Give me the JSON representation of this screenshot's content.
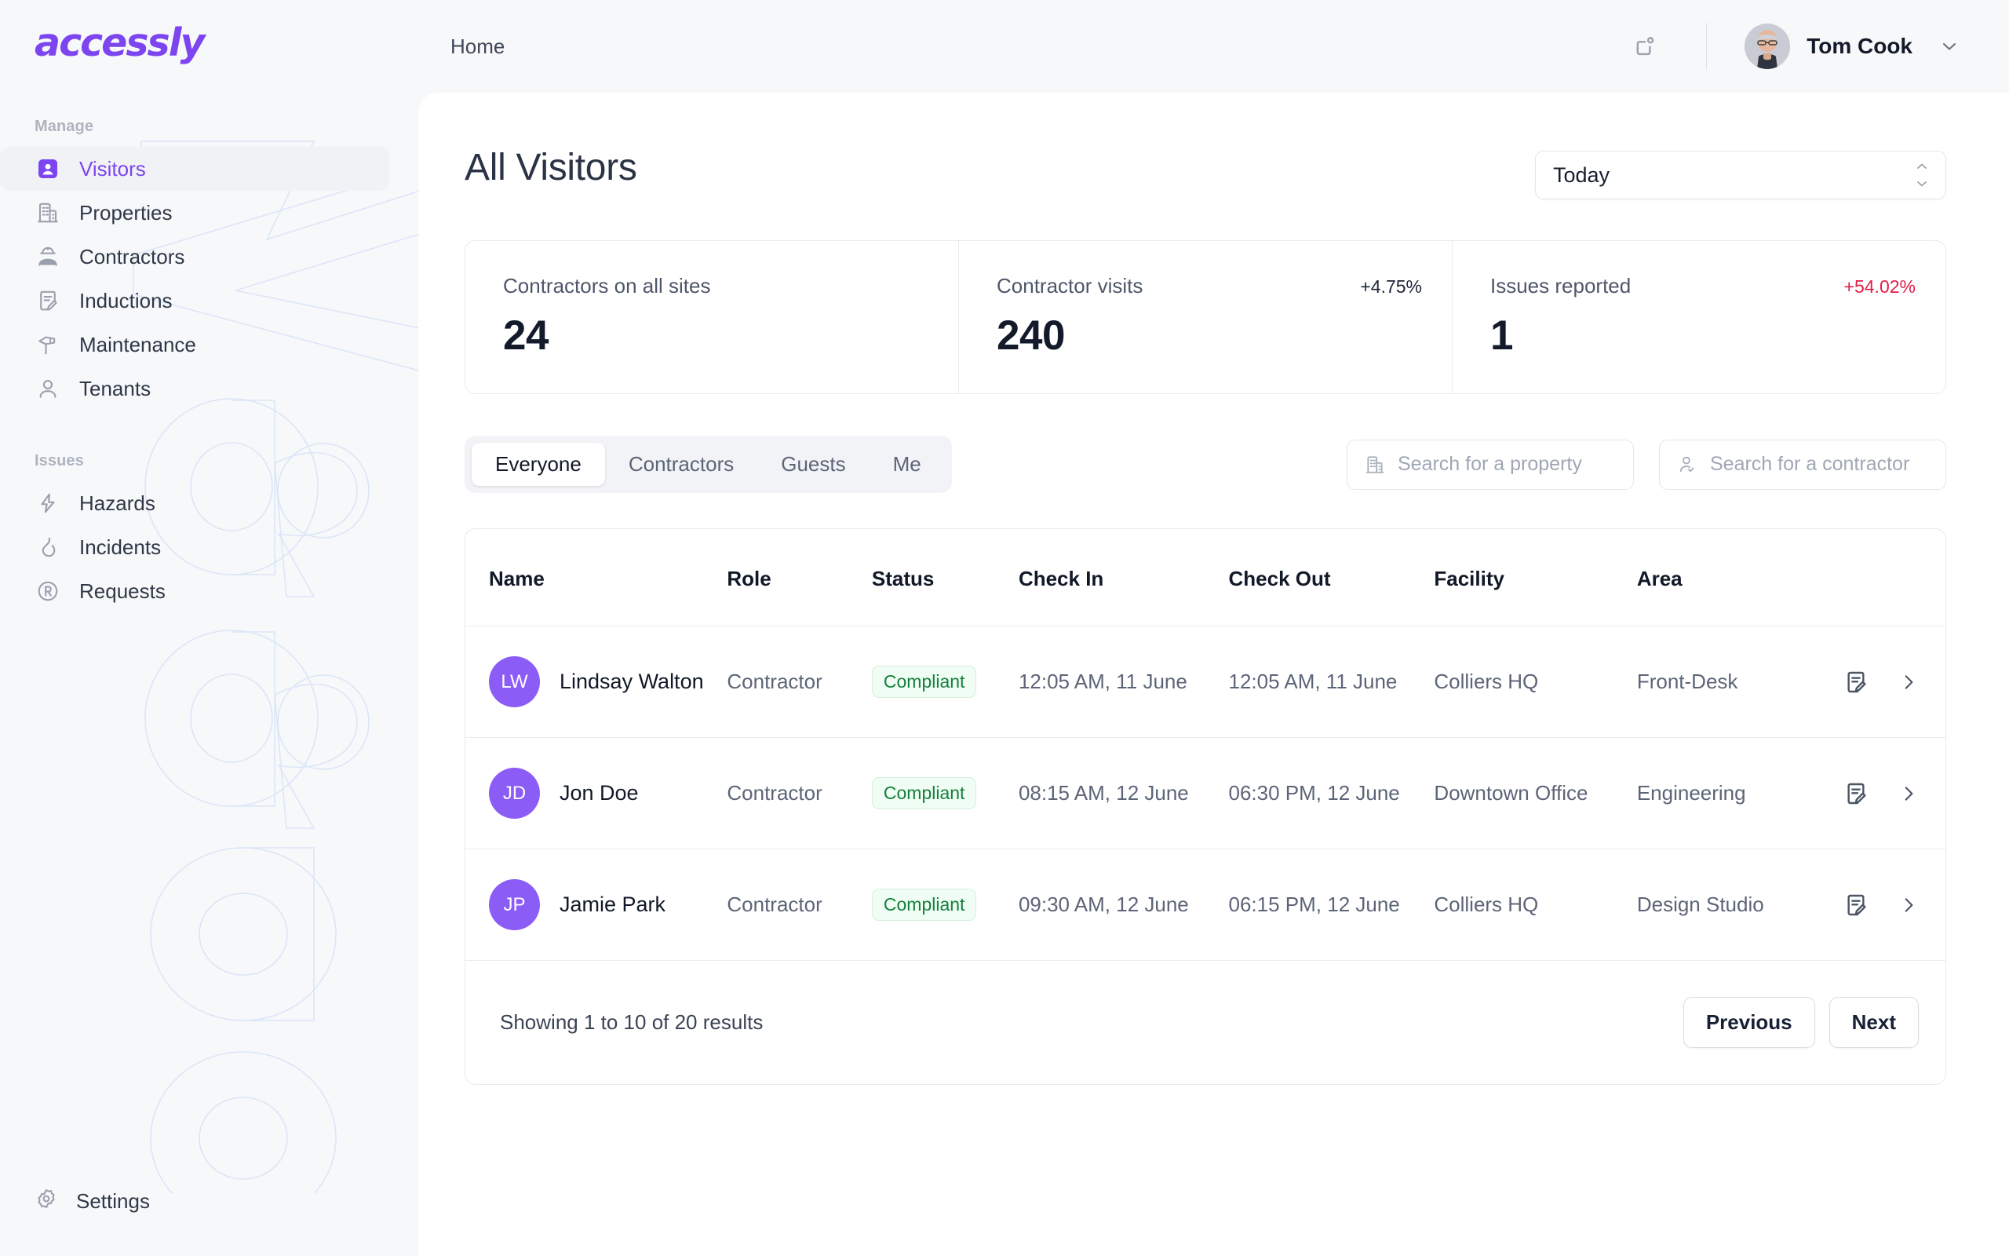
{
  "brand": {
    "logo_text": "accessly",
    "accent": "#7c45f0"
  },
  "topbar": {
    "breadcrumb": "Home",
    "notification_icon": "notification-square-icon",
    "user_name": "Tom Cook",
    "chevron_icon": "chevron-down-icon"
  },
  "sidebar": {
    "sections": [
      {
        "label": "Manage",
        "items": [
          {
            "label": "Visitors",
            "icon": "user-card-icon",
            "active": true
          },
          {
            "label": "Properties",
            "icon": "building-icon",
            "active": false
          },
          {
            "label": "Contractors",
            "icon": "hardhat-worker-icon",
            "active": false
          },
          {
            "label": "Inductions",
            "icon": "document-edit-icon",
            "active": false
          },
          {
            "label": "Maintenance",
            "icon": "hammer-icon",
            "active": false
          },
          {
            "label": "Tenants",
            "icon": "person-icon",
            "active": false
          }
        ]
      },
      {
        "label": "Issues",
        "items": [
          {
            "label": "Hazards",
            "icon": "lightning-bolt-icon",
            "active": false
          },
          {
            "label": "Incidents",
            "icon": "flame-icon",
            "active": false
          },
          {
            "label": "Requests",
            "icon": "registered-circle-icon",
            "active": false
          }
        ]
      }
    ],
    "settings": {
      "label": "Settings",
      "icon": "gear-icon"
    },
    "watermark_text": "accessly"
  },
  "main": {
    "page_title": "All Visitors",
    "date_filter": {
      "value": "Today",
      "icon": "up-down-chevron-icon"
    },
    "stats": [
      {
        "label": "Contractors on all sites",
        "value": "24",
        "delta": "",
        "delta_negative": false
      },
      {
        "label": "Contractor visits",
        "value": "240",
        "delta": "+4.75%",
        "delta_negative": false
      },
      {
        "label": "Issues reported",
        "value": "1",
        "delta": "+54.02%",
        "delta_negative": true
      }
    ],
    "tabs": [
      {
        "label": "Everyone",
        "active": true
      },
      {
        "label": "Contractors",
        "active": false
      },
      {
        "label": "Guests",
        "active": false
      },
      {
        "label": "Me",
        "active": false
      }
    ],
    "searches": [
      {
        "placeholder": "Search for a property",
        "value": "",
        "icon": "building-icon",
        "name": "property-search-input"
      },
      {
        "placeholder": "Search for a contractor",
        "value": "",
        "icon": "person-check-icon",
        "name": "contractor-search-input"
      }
    ],
    "table": {
      "columns": [
        "Name",
        "Role",
        "Status",
        "Check In",
        "Check Out",
        "Facility",
        "Area",
        ""
      ],
      "rows": [
        {
          "initials": "LW",
          "name": "Lindsay Walton",
          "role": "Contractor",
          "status": "Compliant",
          "check_in": "12:05 AM, 11 June",
          "check_out": "12:05 AM, 11 June",
          "facility": "Colliers HQ",
          "area": "Front-Desk"
        },
        {
          "initials": "JD",
          "name": "Jon Doe",
          "role": "Contractor",
          "status": "Compliant",
          "check_in": "08:15 AM, 12 June",
          "check_out": "06:30 PM, 12 June",
          "facility": "Downtown Office",
          "area": "Engineering"
        },
        {
          "initials": "JP",
          "name": "Jamie Park",
          "role": "Contractor",
          "status": "Compliant",
          "check_in": "09:30 AM, 12 June",
          "check_out": "06:15 PM, 12 June",
          "facility": "Colliers HQ",
          "area": "Design Studio"
        }
      ],
      "row_actions": {
        "edit_icon": "document-edit-icon",
        "open_icon": "chevron-right-icon"
      }
    },
    "pagination": {
      "summary": "Showing 1 to 10 of 20 results",
      "previous": "Previous",
      "next": "Next"
    }
  },
  "colors": {
    "accent": "#7c45f0",
    "avatar": "#8b5cf6",
    "badge_text": "#15803d",
    "badge_bg": "#f0fdf4",
    "delta_negative": "#e11d48",
    "page_bg": "#f7f8fa",
    "panel_bg": "#ffffff"
  }
}
